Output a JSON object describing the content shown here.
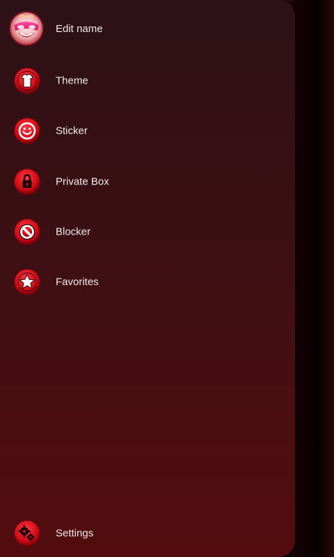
{
  "profile": {
    "name_label": "Edit name",
    "avatar_icon": "masked-face-avatar"
  },
  "menu": {
    "items": [
      {
        "label": "Theme",
        "icon": "tshirt-icon"
      },
      {
        "label": "Sticker",
        "icon": "smiley-icon"
      },
      {
        "label": "Private Box",
        "icon": "lock-icon"
      },
      {
        "label": "Blocker",
        "icon": "block-icon"
      },
      {
        "label": "Favorites",
        "icon": "star-icon"
      }
    ]
  },
  "footer": {
    "settings_label": "Settings",
    "settings_icon": "gears-icon"
  },
  "colors": {
    "accent": "#e0101e",
    "drawer_top": "#2c1116",
    "drawer_bottom": "#520c0e",
    "text": "#f4eaea"
  }
}
